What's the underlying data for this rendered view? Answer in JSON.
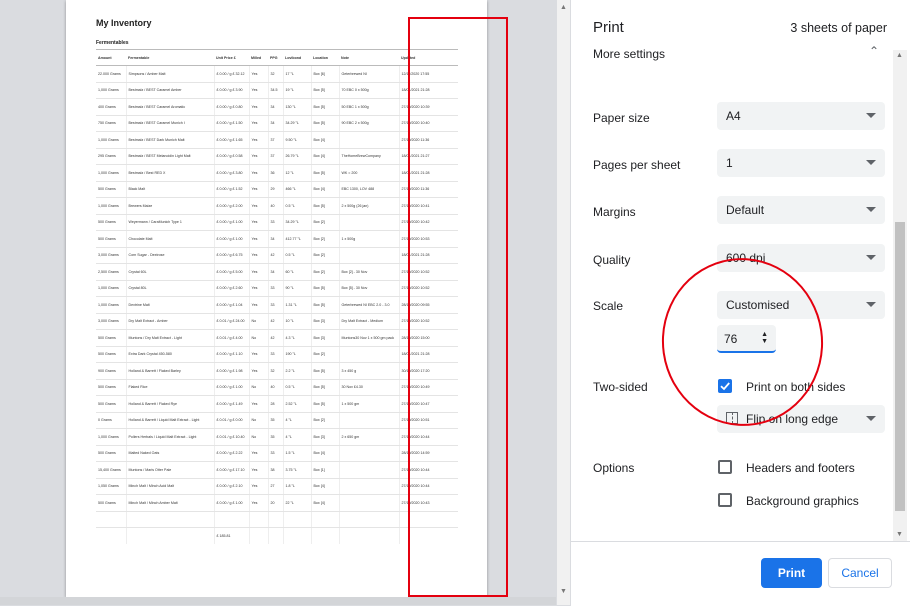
{
  "document": {
    "title": "My Inventory",
    "subtitle": "Fermentables",
    "columns": [
      "Amount",
      "Fermentable",
      "Unit Price £",
      "Milled",
      "PPG",
      "Lovibond",
      "Location",
      "Note",
      "Updated"
    ],
    "rows": [
      [
        "22.000 Grams",
        "Simpsons / Amber Malt",
        "£ 0.00 / g £ 32.12",
        "Yes",
        "32",
        "17 °L",
        "Box [6]",
        "Geterbrewed NI",
        "12/11/2020 17:55"
      ],
      [
        "1,000 Grams",
        "Bestmalz / BEST Caramel Amber",
        "£ 0.00 / g £ 3.90",
        "Yes",
        "34.5",
        "19 °L",
        "Box [5]",
        "70 EBC 0 x 500g",
        "18/01/2021 21:28"
      ],
      [
        "400 Grams",
        "Bestmalz / BEST Caramel Aromatic",
        "£ 0.00 / g £ 0.80",
        "Yes",
        "34",
        "130 °L",
        "Box [5]",
        "50 EBC 1 x 500g",
        "27/10/2020 10:39"
      ],
      [
        "750 Grams",
        "Bestmalz / BEST Caramel Munich I",
        "£ 0.00 / g £ 1.50",
        "Yes",
        "34",
        "34.29 °L",
        "Box [5]",
        "90 EBC 2 x 500g",
        "27/10/2020 10:40"
      ],
      [
        "1,000 Grams",
        "Bestmalz / BEST Dark Munich Malt",
        "£ 0.00 / g £ 1.65",
        "Yes",
        "37",
        "9.50 °L",
        "Box [4]",
        "",
        "27/10/2020 11:36"
      ],
      [
        "295 Grams",
        "Bestmalz / BEST Melanoidin Light Malt",
        "£ 0.00 / g £ 0.58",
        "Yes",
        "37",
        "26.79 °L",
        "Box [4]",
        "TheHomeBrewCompany",
        "18/01/2021 21:27"
      ],
      [
        "1,000 Grams",
        "Bestmalz / Best RED X",
        "£ 0.00 / g £ 3.80",
        "Yes",
        "36",
        "12 °L",
        "Box [5]",
        "WK = 200",
        "18/01/2021 21:28"
      ],
      [
        "500 Grams",
        "Black Malt",
        "£ 0.00 / g £ 1.52",
        "Yes",
        "29",
        "466 °L",
        "Box [4]",
        "EBC 1300, LOV 488",
        "27/10/2020 11:36"
      ],
      [
        "1,000 Grams",
        "Brewers Maize",
        "£ 0.00 / g £ 2.00",
        "Yes",
        "40",
        "0.5 °L",
        "Box [5]",
        "2 x 500g (26 jan)",
        "27/10/2020 10:41"
      ],
      [
        "500 Grams",
        "Weyermann / CaraMunich Type 1",
        "£ 0.00 / g £ 1.00",
        "Yes",
        "33",
        "34.29 °L",
        "Box [2]",
        "",
        "27/10/2020 10:42"
      ],
      [
        "500 Grams",
        "Chocolate Malt",
        "£ 0.00 / g £ 1.00",
        "Yes",
        "34",
        "412.77 °L",
        "Box [2]",
        "1 x 500g",
        "27/10/2020 10:53"
      ],
      [
        "3,000 Grams",
        "Corn Sugar - Dextrose",
        "£ 0.00 / g £ 6.75",
        "Yes",
        "42",
        "0.5 °L",
        "Box [2]",
        "",
        "18/01/2021 21:28"
      ],
      [
        "2,500 Grams",
        "Crystal 60L",
        "£ 0.00 / g £ 5.00",
        "Yes",
        "34",
        "60 °L",
        "Box [2]",
        "Box [2] - 30 Nov",
        "27/10/2020 10:52"
      ],
      [
        "1,000 Grams",
        "Crystal 80L",
        "£ 0.00 / g £ 2.60",
        "Yes",
        "33",
        "90 °L",
        "Box [5]",
        "Box [5] - 30 Nov",
        "27/10/2020 10:52"
      ],
      [
        "1,000 Grams",
        "Dextrine Malt",
        "£ 0.00 / g £ 1.04",
        "Yes",
        "33",
        "1.31 °L",
        "Box [5]",
        "Geterbrewed NI EBC 2.0 - 3.0",
        "28/10/2020 09:55"
      ],
      [
        "3,000 Grams",
        "Dry Malt Extract - Amber",
        "£ 0.01 / g £ 24.00",
        "No",
        "42",
        "10 °L",
        "Box [3]",
        "Dry Malt Extract - Medium",
        "27/10/2020 10:52"
      ],
      [
        "500 Grams",
        "Muntons / Dry Malt Extract - Light",
        "£ 0.01 / g £ 4.00",
        "No",
        "42",
        "4.3 °L",
        "Box [3]",
        "Muntons30 Nov 1 x 500 gm pack",
        "28/10/2020 15:00"
      ],
      [
        "500 Grams",
        "Extra Dark Crystal 450-580",
        "£ 0.00 / g £ 1.10",
        "Yes",
        "33",
        "190 °L",
        "Box [2]",
        "",
        "18/01/2021 21:28"
      ],
      [
        "900 Grams",
        "Holland & Barrett / Flaked Barley",
        "£ 0.00 / g £ 1.98",
        "Yes",
        "32",
        "2.2 °L",
        "Box [5]",
        "3 x 450 g",
        "30/10/2020 17:20"
      ],
      [
        "500 Grams",
        "Flaked Rice",
        "£ 0.00 / g £ 1.00",
        "No",
        "40",
        "0.5 °L",
        "Box [5]",
        "30 Nov £4.30",
        "27/10/2020 10:49"
      ],
      [
        "500 Grams",
        "Holland & Barrett / Flaked Rye",
        "£ 0.00 / g £ 1.49",
        "Yes",
        "28",
        "2.52 °L",
        "Box [5]",
        "1 x 500 gm",
        "27/10/2020 10:47"
      ],
      [
        "0 Grams",
        "Holland & Barrett / Liquid Malt Extract - Light",
        "£ 0.01 / g £ 0.00",
        "No",
        "35",
        "4 °L",
        "Box [2]",
        "",
        "27/10/2020 10:51"
      ],
      [
        "1,000 Grams",
        "Pollers Herbals / Liquid Malt Extract - Light",
        "£ 0.01 / g £ 10.40",
        "No",
        "35",
        "4 °L",
        "Box [3]",
        "2 x 650 gm",
        "27/10/2020 10:44"
      ],
      [
        "500 Grams",
        "Malted Naked Oats",
        "£ 0.00 / g £ 2.22",
        "Yes",
        "33",
        "1.5 °L",
        "Box [4]",
        "",
        "28/10/2020 14:59"
      ],
      [
        "15,400 Grams",
        "Muntons / Maris Otter Pale",
        "£ 0.00 / g £ 17.10",
        "Yes",
        "38",
        "3.75 °L",
        "Box [1]",
        "",
        "27/10/2020 10:44"
      ],
      [
        "1,050 Grams",
        "Minch Malt / Minch Acid Malt",
        "£ 0.00 / g £ 2.10",
        "Yes",
        "27",
        "1.8 °L",
        "Box [4]",
        "",
        "27/10/2020 10:44"
      ],
      [
        "500 Grams",
        "Minch Malt / Minch Amber Malt",
        "£ 0.00 / g £ 1.00",
        "Yes",
        "20",
        "22 °L",
        "Box [4]",
        "",
        "27/10/2020 10:43"
      ],
      [
        "",
        "",
        "",
        "",
        "",
        "",
        "",
        "",
        ""
      ]
    ],
    "total_price": "£ 185.81"
  },
  "print_panel": {
    "title": "Print",
    "sheet_count": "3 sheets of paper",
    "more_settings_label": "More settings",
    "paper_size": {
      "label": "Paper size",
      "value": "A4"
    },
    "pages_per_sheet": {
      "label": "Pages per sheet",
      "value": "1"
    },
    "margins": {
      "label": "Margins",
      "value": "Default"
    },
    "quality": {
      "label": "Quality",
      "value": "600 dpi"
    },
    "scale": {
      "label": "Scale",
      "value": "Customised",
      "custom_value": "76"
    },
    "two_sided": {
      "label": "Two-sided",
      "checkbox_label": "Print on both sides",
      "checked": true,
      "flip_value": "Flip on long edge"
    },
    "options": {
      "label": "Options",
      "headers_footers": "Headers and footers",
      "background_graphics": "Background graphics"
    },
    "print_button": "Print",
    "cancel_button": "Cancel"
  },
  "annotations": {
    "highlight_color": "#e4000f"
  },
  "colors": {
    "accent": "#1a73e8",
    "select_bg": "#f1f3f4"
  }
}
